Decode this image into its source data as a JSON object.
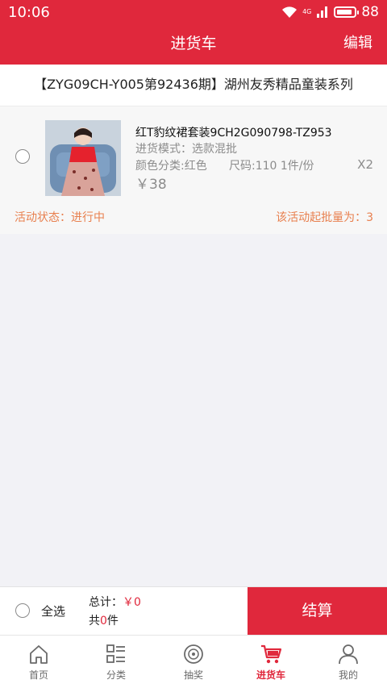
{
  "status_bar": {
    "time": "10:06",
    "network": "4G",
    "battery": "88"
  },
  "nav": {
    "title": "进货车",
    "edit_label": "编辑"
  },
  "shop": {
    "header": "【ZYG09CH-Y005第92436期】湖州友秀精品童装系列"
  },
  "cart_items": [
    {
      "title": "红T豹纹裙套装9CH2G090798-TZ953",
      "mode": "进货模式：选款混批",
      "spec": "颜色分类:红色",
      "size": "尺码:110 1件/份",
      "price": "￥38",
      "qty": "X2",
      "activity_status": "活动状态：进行中",
      "activity_min": "该活动起批量为：3"
    }
  ],
  "checkout": {
    "select_all_label": "全选",
    "total_label": "总计：",
    "total_value": "￥0",
    "count_prefix": "共",
    "count_value": "0",
    "count_suffix": "件",
    "button_label": "结算"
  },
  "tabs": [
    {
      "label": "首页",
      "icon": "home-icon"
    },
    {
      "label": "分类",
      "icon": "category-icon"
    },
    {
      "label": "抽奖",
      "icon": "lottery-icon"
    },
    {
      "label": "进货车",
      "icon": "cart-icon",
      "active": true
    },
    {
      "label": "我的",
      "icon": "user-icon"
    }
  ],
  "colors": {
    "brand": "#e0283c",
    "activity": "#e8804f"
  }
}
